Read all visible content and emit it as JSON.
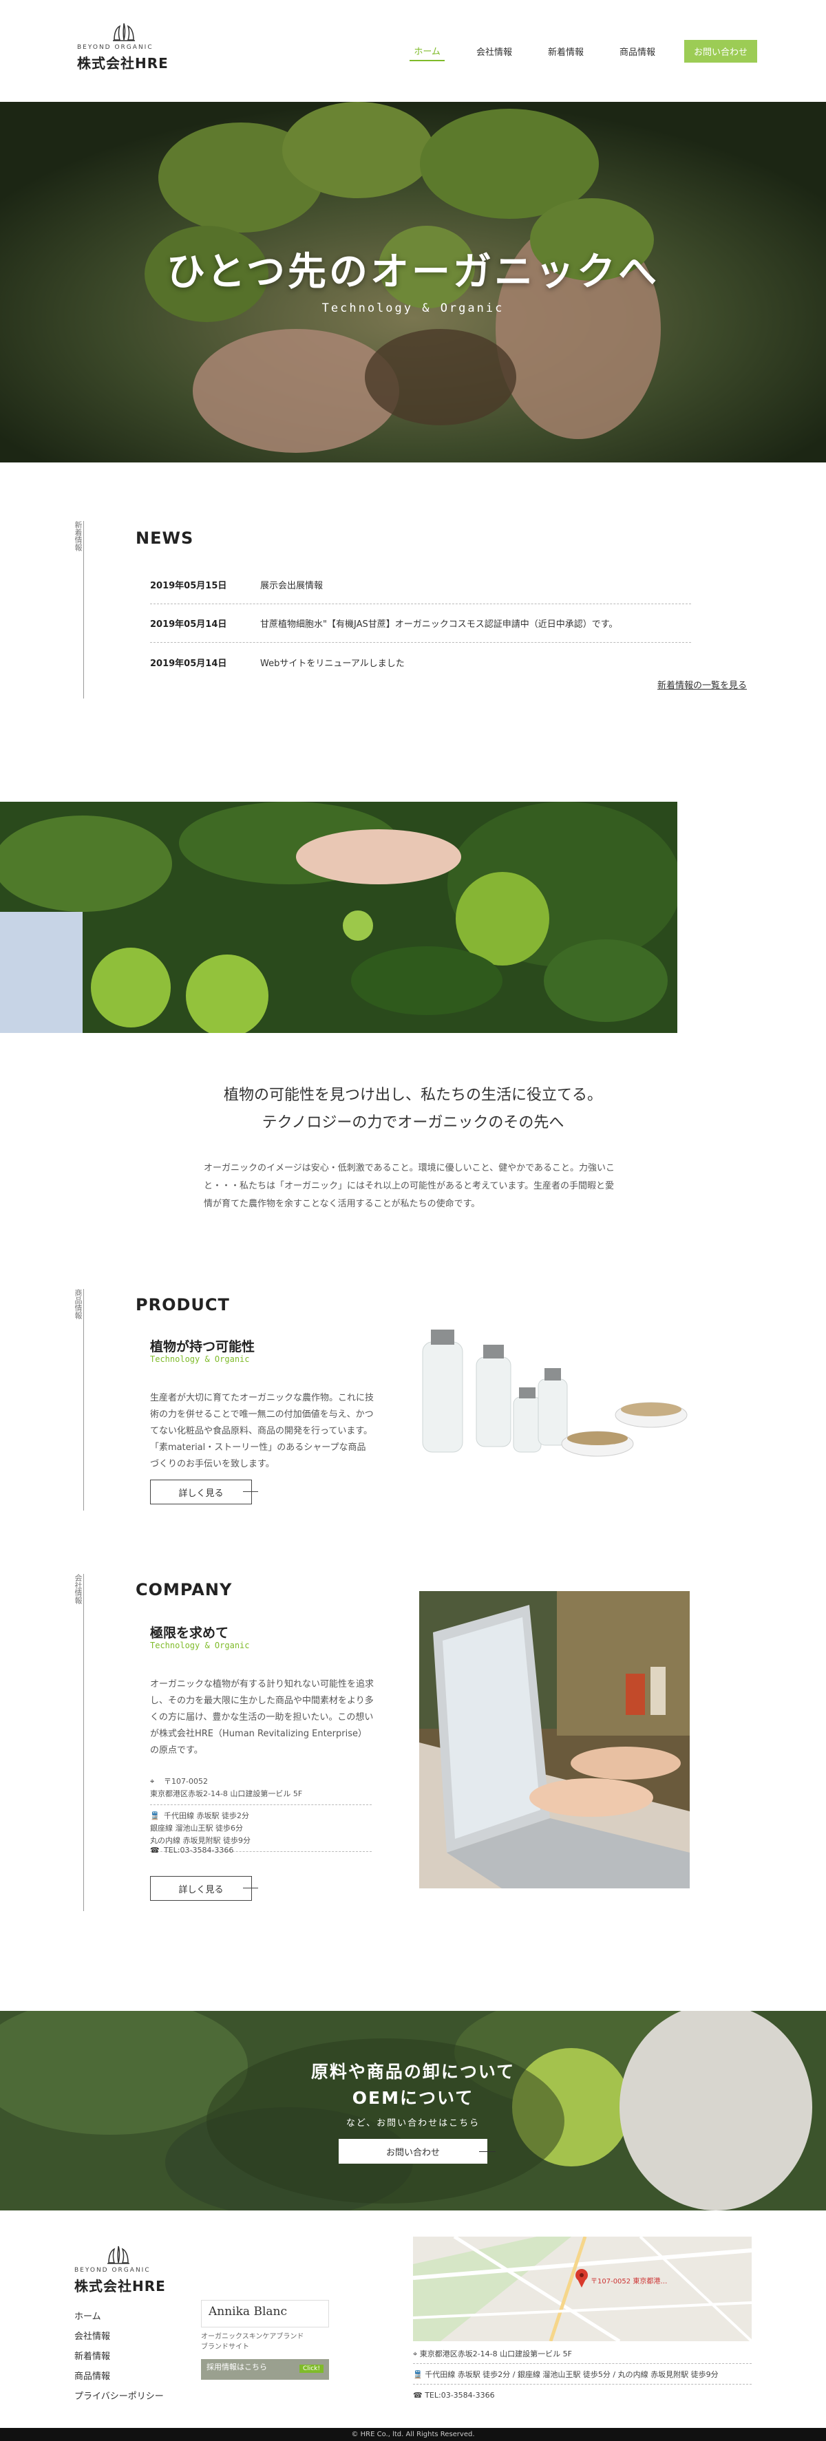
{
  "header": {
    "logo_tagline": "BEYOND ORGANIC",
    "logo_name": "株式会社HRE",
    "nav": [
      {
        "label": "ホーム"
      },
      {
        "label": "会社情報"
      },
      {
        "label": "新着情報"
      },
      {
        "label": "商品情報"
      }
    ],
    "contact_label": "お問い合わせ",
    "accent_color": "#7fbb2a"
  },
  "hero": {
    "title": "ひとつ先のオーガニックへ",
    "subtitle": "Technology & Organic"
  },
  "news": {
    "side_label": "新着情報",
    "title": "NEWS",
    "items": [
      {
        "date": "2019年05月15日",
        "title": "展示会出展情報"
      },
      {
        "date": "2019年05月14日",
        "title": "甘蔗植物細胞水\"【有機JAS甘蔗】オーガニックコスモス認証申請中（近日中承認）です。"
      },
      {
        "date": "2019年05月14日",
        "title": "Webサイトをリニューアルしました"
      }
    ],
    "more_label": "新着情報の一覧を見る"
  },
  "intro": {
    "heading_line1": "植物の可能性を見つけ出し、私たちの生活に役立てる。",
    "heading_line2": "テクノロジーの力でオーガニックのその先へ",
    "body": "オーガニックのイメージは安心・低刺激であること。環境に優しいこと、健やかであること。力強いこと・・・私たちは「オーガニック」にはそれ以上の可能性があると考えています。生産者の手間暇と愛情が育てた農作物を余すことなく活用することが私たちの使命です。"
  },
  "product": {
    "side_label": "商品情報",
    "title": "PRODUCT",
    "heading": "植物が持つ可能性",
    "heading_en": "Technology & Organic",
    "body": "生産者が大切に育てたオーガニックな農作物。これに技術の力を併せることで唯一無二の付加価値を与え、かつてない化粧品や食品原料、商品の開発を行っています。「素material・ストーリー性」のあるシャープな商品づくりのお手伝いを致します。",
    "button_label": "詳しく見る"
  },
  "company": {
    "side_label": "会社情報",
    "title": "COMPANY",
    "heading": "極限を求めて",
    "heading_en": "Technology & Organic",
    "body": "オーガニックな植物が有する計り知れない可能性を追求し、その力を最大限に生かした商品や中間素材をより多くの方に届け、豊かな生活の一助を担いたい。この想いが株式会社HRE（Human Revitalizing Enterprise）の原点です。",
    "address": "〒107-0052\n東京都港区赤坂2-14-8 山口建設第一ビル 5F",
    "access": "千代田線 赤坂駅 徒歩2分\n銀座線 溜池山王駅 徒歩6分\n丸の内線 赤坂見附駅 徒歩9分",
    "tel": "TEL:03-3584-3366",
    "button_label": "詳しく見る"
  },
  "cta": {
    "title_line1": "原料や商品の卸について",
    "title_line2": "OEMについて",
    "subtitle": "など、お問い合わせはこちら",
    "button_label": "お問い合わせ"
  },
  "footer": {
    "logo_tagline": "BEYOND ORGANIC",
    "logo_name": "株式会社HRE",
    "links": [
      {
        "label": "ホーム"
      },
      {
        "label": "会社情報"
      },
      {
        "label": "新着情報"
      },
      {
        "label": "商品情報"
      },
      {
        "label": "プライバシーポリシー"
      }
    ],
    "brand_name": "Annika Blanc",
    "brand_desc": "オーガニックスキンケアブランド\nブランドサイト",
    "recruit_label": "採用情報はこちら",
    "recruit_tag": "Click!",
    "map_pin_label": "〒107-0052 東京都港…",
    "address": "東京都港区赤坂2-14-8 山口建設第一ビル 5F",
    "access": "千代田線 赤坂駅 徒歩2分 / 銀座線 溜池山王駅 徒歩5分 / 丸の内線 赤坂見附駅 徒歩9分",
    "tel": "TEL:03-3584-3366",
    "copyright": "© HRE Co., ltd. All Rights Reserved."
  }
}
